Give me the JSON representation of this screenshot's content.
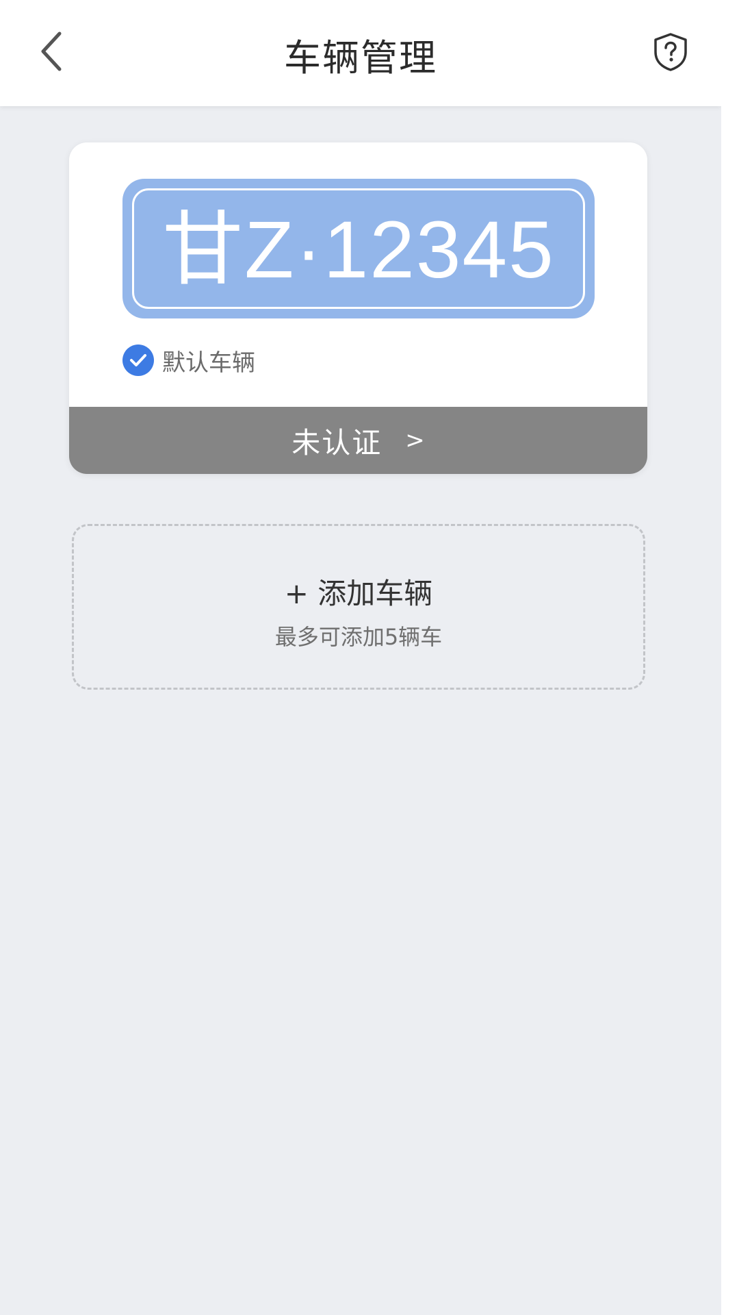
{
  "header": {
    "title": "车辆管理",
    "back_icon": "chevron-left-icon",
    "help_icon": "shield-question-icon"
  },
  "vehicle": {
    "plate_number": "甘Z·12345",
    "default_label": "默认车辆",
    "is_default": true,
    "certification_status": "未认证",
    "certification_arrow": ">"
  },
  "add_vehicle": {
    "title": "+ 添加车辆",
    "subtitle": "最多可添加5辆车"
  },
  "colors": {
    "plate_background": "#93b6ea",
    "accent_blue": "#3d7be3",
    "cert_bar": "#858585",
    "page_background": "#eceef2"
  }
}
